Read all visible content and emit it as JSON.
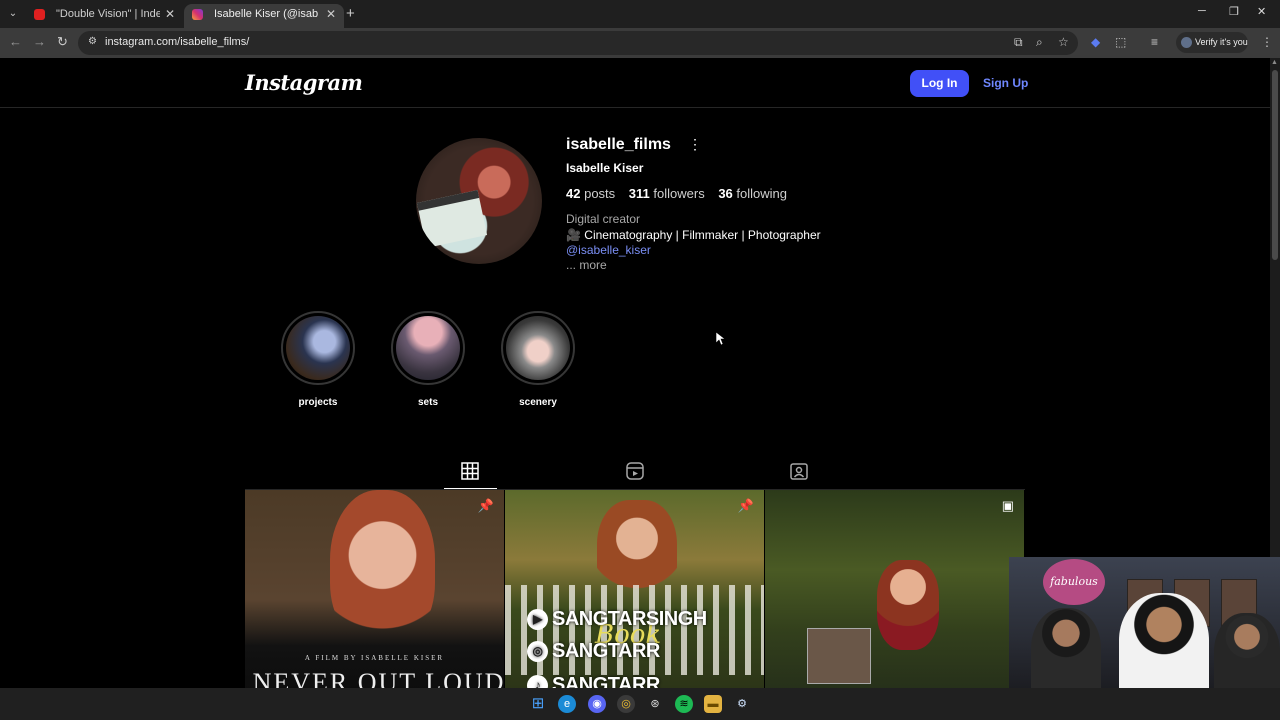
{
  "browser": {
    "tabs": [
      {
        "title": "\"Double Vision\" | Independent",
        "close": "✕"
      },
      {
        "title": "Isabelle Kiser (@isabelle_films)",
        "close": "✕"
      }
    ],
    "new_tab": "+",
    "url": "instagram.com/isabelle_films/",
    "verify_label": "Verify it's you",
    "window_controls": {
      "minimize": "─",
      "maximize": "❐",
      "close": "✕"
    }
  },
  "header": {
    "logo": "Instagram",
    "login_label": "Log In",
    "signup_label": "Sign Up"
  },
  "profile": {
    "username": "isabelle_films",
    "options": "⋮",
    "full_name": "Isabelle Kiser",
    "posts_count": "42",
    "posts_label": "posts",
    "followers_count": "311",
    "followers_label": "followers",
    "following_count": "36",
    "following_label": "following",
    "category": "Digital creator",
    "bio_line": "🎥 Cinematography | Filmmaker | Photographer",
    "mention": "@isabelle_kiser",
    "more": "... more"
  },
  "highlights": [
    {
      "label": "projects"
    },
    {
      "label": "sets"
    },
    {
      "label": "scenery"
    }
  ],
  "post_tabs": [
    {
      "icon": "grid-icon",
      "active": true
    },
    {
      "icon": "reels-icon",
      "active": false
    },
    {
      "icon": "tagged-icon",
      "active": false
    }
  ],
  "posts": [
    {
      "credit": "A FILM BY ISABELLE KISER",
      "title": "NEVER OUT LOUD",
      "badge": "pin-icon"
    },
    {
      "overlay_lines": [
        "SANGTARSINGH",
        "SANGTARR",
        "SANGTARR"
      ],
      "script": "Book",
      "badge": "pin-icon"
    },
    {
      "badge": "reel-icon"
    }
  ],
  "webcam": {
    "balloon_text": "fabulous"
  },
  "colors": {
    "login_button": "#4150f7",
    "link": "#7b8ff5",
    "background": "#000000"
  }
}
